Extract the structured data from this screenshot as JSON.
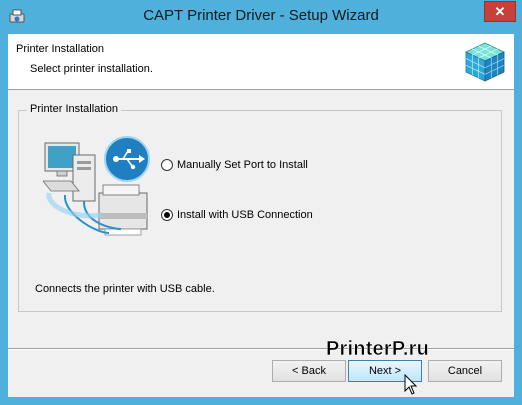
{
  "window": {
    "title": "CAPT Printer Driver - Setup Wizard",
    "close_label": "✕",
    "frame_color": "#4eb0db",
    "close_color": "#c7403a"
  },
  "header": {
    "title": "Printer Installation",
    "subtitle": "Select printer installation."
  },
  "group": {
    "legend": "Printer Installation",
    "options": [
      {
        "label": "Manually Set Port to Install",
        "selected": false
      },
      {
        "label": "Install with USB Connection",
        "selected": true
      }
    ],
    "description": "Connects the printer with USB cable."
  },
  "buttons": {
    "back": "< Back",
    "next": "Next >",
    "cancel": "Cancel"
  },
  "watermark": "PrinterP.ru",
  "icons": [
    "app-icon",
    "cube-logo-icon",
    "computer-printer-usb-icon",
    "usb-icon",
    "mouse-cursor-icon"
  ]
}
